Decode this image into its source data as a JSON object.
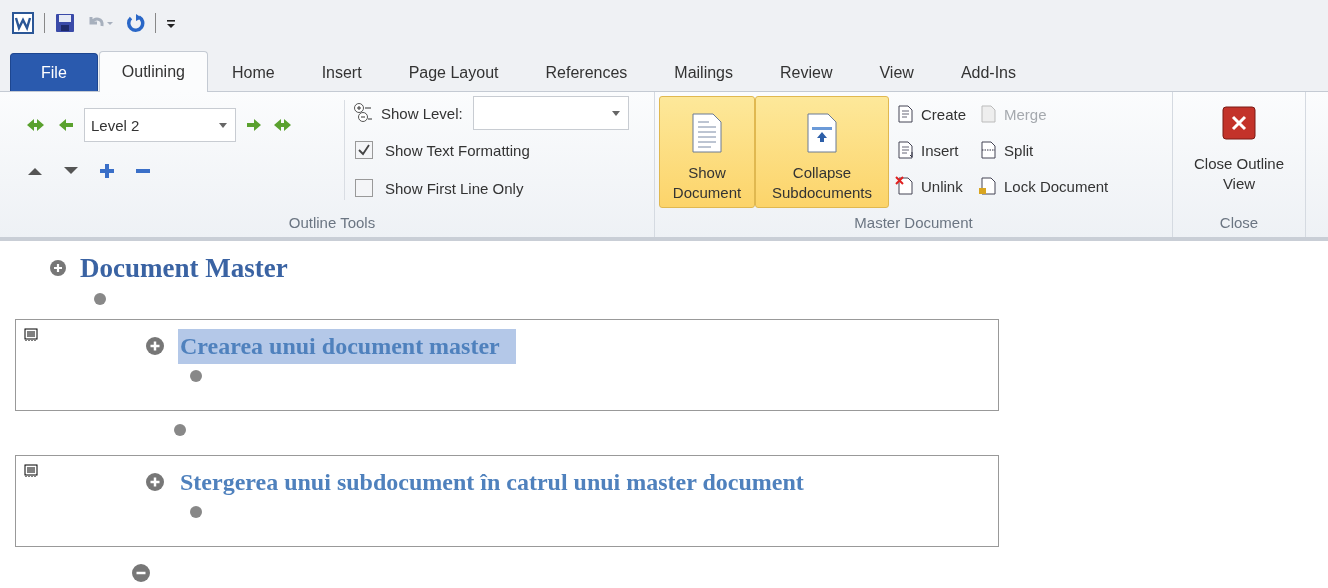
{
  "tabs": [
    {
      "label": "File",
      "kind": "file",
      "selected": false
    },
    {
      "label": "Outlining",
      "kind": "tab",
      "selected": true
    },
    {
      "label": "Home",
      "kind": "tab",
      "selected": false
    },
    {
      "label": "Insert",
      "kind": "tab",
      "selected": false
    },
    {
      "label": "Page Layout",
      "kind": "tab",
      "selected": false
    },
    {
      "label": "References",
      "kind": "tab",
      "selected": false
    },
    {
      "label": "Mailings",
      "kind": "tab",
      "selected": false
    },
    {
      "label": "Review",
      "kind": "tab",
      "selected": false
    },
    {
      "label": "View",
      "kind": "tab",
      "selected": false
    },
    {
      "label": "Add-Ins",
      "kind": "tab",
      "selected": false
    }
  ],
  "outline_tools": {
    "level_dropdown": {
      "value": "Level 2"
    },
    "show_level": {
      "label": "Show Level:"
    },
    "checkboxes": [
      {
        "label": "Show Text Formatting",
        "checked": true
      },
      {
        "label": "Show First Line Only",
        "checked": false
      }
    ],
    "group_label": "Outline Tools"
  },
  "master_document": {
    "large_buttons": [
      {
        "label": "Show Document",
        "kind": "show",
        "selected": true
      },
      {
        "label": "Collapse Subdocuments",
        "kind": "collapse",
        "selected": true
      }
    ],
    "small_buttons": [
      {
        "label": "Create",
        "kind": "create",
        "disabled": false
      },
      {
        "label": "Insert",
        "kind": "insert",
        "disabled": false
      },
      {
        "label": "Unlink",
        "kind": "unlink",
        "disabled": false
      },
      {
        "label": "Merge",
        "kind": "merge",
        "disabled": true
      },
      {
        "label": "Split",
        "kind": "split",
        "disabled": false
      },
      {
        "label": "Lock Document",
        "kind": "lock",
        "disabled": false
      }
    ],
    "group_label": "Master Document"
  },
  "close": {
    "label": "Close Outline View",
    "group_label": "Close"
  },
  "outline": [
    {
      "kind": "heading",
      "text": "Document Master",
      "selected": false
    },
    {
      "kind": "body"
    },
    {
      "kind": "subdocument",
      "children": [
        {
          "kind": "heading",
          "text": "Crearea unui document master",
          "selected": true
        },
        {
          "kind": "body"
        }
      ]
    },
    {
      "kind": "body"
    },
    {
      "kind": "subdocument",
      "children": [
        {
          "kind": "heading",
          "text": "Stergerea unui subdocument în catrul unui master document",
          "selected": false
        },
        {
          "kind": "body"
        }
      ]
    },
    {
      "kind": "empty"
    }
  ]
}
